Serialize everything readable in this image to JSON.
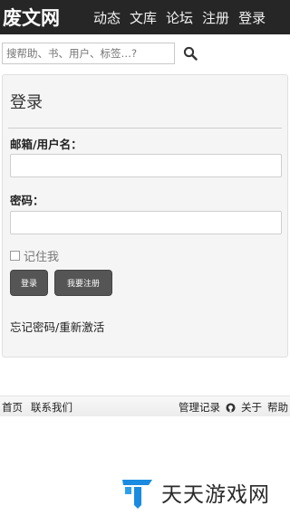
{
  "header": {
    "logo": "废文网",
    "nav": [
      "动态",
      "文库",
      "论坛",
      "注册",
      "登录"
    ]
  },
  "search": {
    "placeholder": "搜帮助、书、用户、标签…?"
  },
  "login": {
    "title": "登录",
    "email_label": "邮箱/用户名：",
    "email_value": "",
    "password_label": "密码：",
    "password_value": "",
    "remember_label": "记住我",
    "login_button": "登录",
    "register_button": "我要注册",
    "forgot_link": "忘记密码/重新激活"
  },
  "footer": {
    "home": "首页",
    "contact": "联系我们",
    "admin_log": "管理记录",
    "about": "关于",
    "help": "帮助"
  },
  "watermark": {
    "text": "天天游戏网"
  },
  "colors": {
    "topbar": "#262626",
    "panel": "#f5f5f5",
    "button": "#555555",
    "watermark_blue": "#1a8be0"
  }
}
